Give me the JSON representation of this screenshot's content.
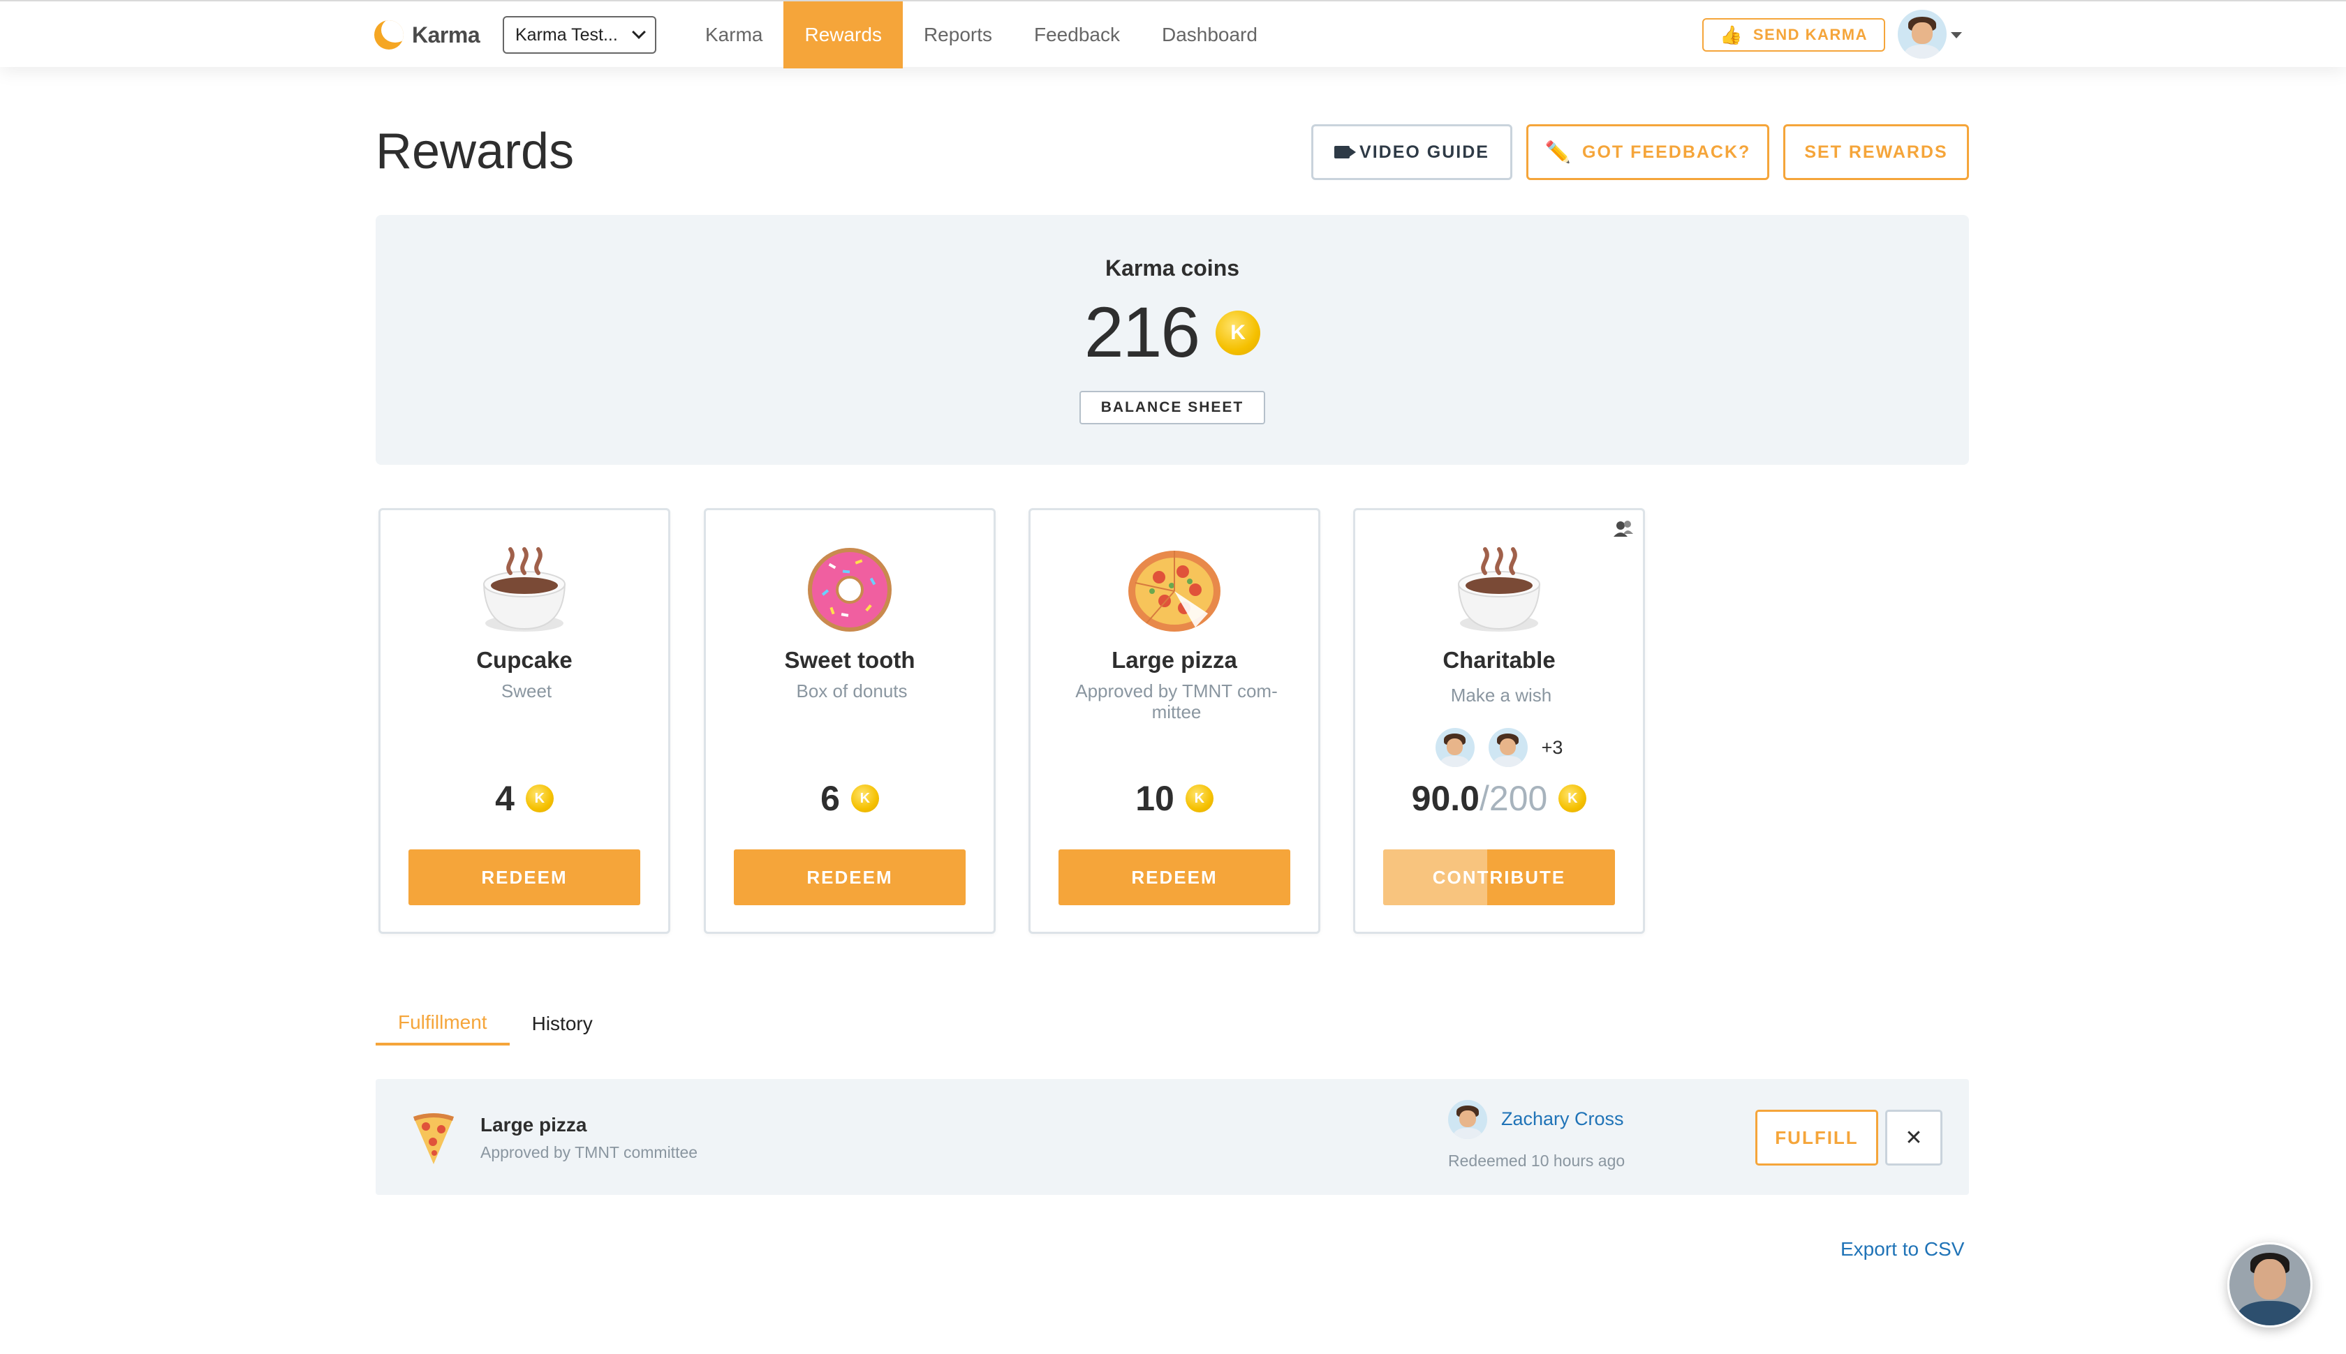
{
  "nav": {
    "brand": "Karma",
    "team_select": "Karma Test...",
    "links": [
      "Karma",
      "Rewards",
      "Reports",
      "Feedback",
      "Dashboard"
    ],
    "active_link": "Rewards",
    "send_karma": "SEND KARMA"
  },
  "header": {
    "title": "Rewards",
    "video_guide": "VIDEO GUIDE",
    "got_feedback": "GOT FEEDBACK?",
    "set_rewards": "SET REWARDS"
  },
  "coins": {
    "label": "Karma coins",
    "value": "216",
    "coin_symbol": "K",
    "balance_sheet": "BALANCE SHEET"
  },
  "cards": [
    {
      "title": "Cupcake",
      "subtitle": "Sweet",
      "price": "4",
      "button": "REDEEM",
      "icon": "coffee-cup-icon"
    },
    {
      "title": "Sweet tooth",
      "subtitle": "Box of donuts",
      "price": "6",
      "button": "REDEEM",
      "icon": "donut-icon"
    },
    {
      "title": "Large pizza",
      "subtitle": "Approved by TMNT com­mittee",
      "price": "10",
      "button": "REDEEM",
      "icon": "pizza-icon"
    },
    {
      "title": "Charitable",
      "subtitle": "Make a wish",
      "price": "90.0",
      "goal": "/200",
      "button": "CONTRIBUTE",
      "extra_contributors": "+3",
      "progress": 0.45,
      "icon": "coffee-cup-icon"
    }
  ],
  "tabs": [
    "Fulfillment",
    "History"
  ],
  "active_tab": "Fulfillment",
  "fulfillment": {
    "title": "Large pizza",
    "subtitle": "Approved by TMNT committee",
    "user": "Zachary Cross",
    "when": "Redeemed 10 hours ago",
    "fulfill": "FULFILL",
    "dismiss": "✕"
  },
  "export": "Export to CSV",
  "colors": {
    "accent": "#f5a53a",
    "link": "#1f73b7",
    "panel": "#f0f4f7"
  }
}
